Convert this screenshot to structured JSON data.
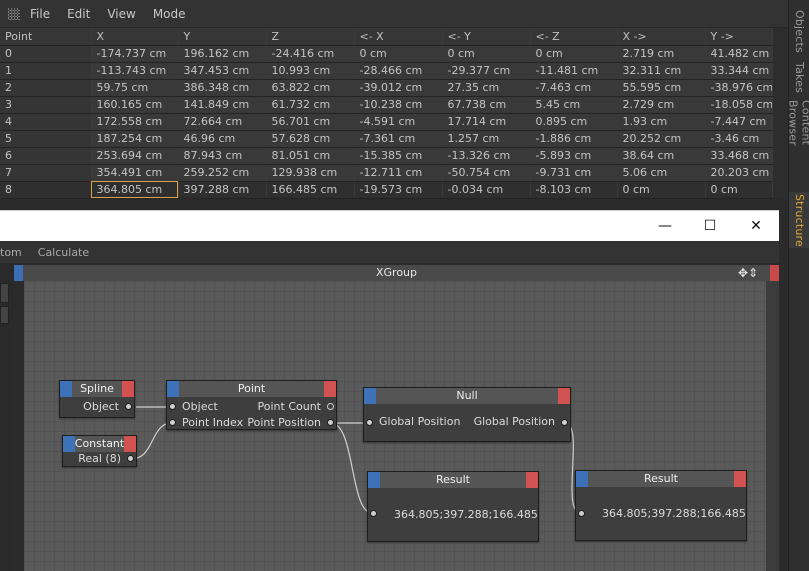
{
  "menubar": {
    "items": [
      "File",
      "Edit",
      "View",
      "Mode"
    ]
  },
  "table": {
    "columns": [
      "Point",
      "X",
      "Y",
      "Z",
      "<- X",
      "<- Y",
      "<- Z",
      "X ->",
      "Y ->"
    ],
    "rows": [
      [
        "0",
        "-174.737 cm",
        "196.162 cm",
        "-24.416 cm",
        "0 cm",
        "0 cm",
        "0 cm",
        "2.719 cm",
        "41.482 cm"
      ],
      [
        "1",
        "-113.743 cm",
        "347.453 cm",
        "10.993 cm",
        "-28.466 cm",
        "-29.377 cm",
        "-11.481 cm",
        "32.311 cm",
        "33.344 cm"
      ],
      [
        "2",
        "59.75 cm",
        "386.348 cm",
        "63.822 cm",
        "-39.012 cm",
        "27.35 cm",
        "-7.463 cm",
        "55.595 cm",
        "-38.976 cm"
      ],
      [
        "3",
        "160.165 cm",
        "141.849 cm",
        "61.732 cm",
        "-10.238 cm",
        "67.738 cm",
        "5.45 cm",
        "2.729 cm",
        "-18.058 cm"
      ],
      [
        "4",
        "172.558 cm",
        "72.664 cm",
        "56.701 cm",
        "-4.591 cm",
        "17.714 cm",
        "0.895 cm",
        "1.93 cm",
        "-7.447 cm"
      ],
      [
        "5",
        "187.254 cm",
        "46.96 cm",
        "57.628 cm",
        "-7.361 cm",
        "1.257 cm",
        "-1.886 cm",
        "20.252 cm",
        "-3.46 cm"
      ],
      [
        "6",
        "253.694 cm",
        "87.943 cm",
        "81.051 cm",
        "-15.385 cm",
        "-13.326 cm",
        "-5.893 cm",
        "38.64 cm",
        "33.468 cm"
      ],
      [
        "7",
        "354.491 cm",
        "259.252 cm",
        "129.938 cm",
        "-12.711 cm",
        "-50.754 cm",
        "-9.731 cm",
        "5.06 cm",
        "20.203 cm"
      ],
      [
        "8",
        "364.805 cm",
        "397.288 cm",
        "166.485 cm",
        "-19.573 cm",
        "-0.034 cm",
        "-8.103 cm",
        "0 cm",
        "0 cm"
      ]
    ],
    "selected_row": 8
  },
  "side_tabs": [
    "Objects",
    "Takes",
    "Content Browser",
    "Structure"
  ],
  "active_side_tab": "Structure",
  "window_controls": {
    "minimize": "—",
    "maximize": "☐",
    "close": "✕"
  },
  "xpresso": {
    "menu": [
      "tom",
      "Calculate"
    ],
    "group_title": "XGroup",
    "header_icons": "✥⇕",
    "nodes": {
      "spline": {
        "title": "Spline",
        "out_port": "Object"
      },
      "constant": {
        "title": "Constant",
        "out_port": "Real (8)"
      },
      "point": {
        "title": "Point",
        "in_ports": [
          "Object",
          "Point Index"
        ],
        "out_ports": [
          "Point Count",
          "Point Position"
        ]
      },
      "null": {
        "title": "Null",
        "in_port": "Global Position",
        "out_port": "Global Position"
      },
      "result1": {
        "title": "Result",
        "value": "364.805;397.288;166.485"
      },
      "result2": {
        "title": "Result",
        "value": "364.805;397.288;166.485"
      }
    }
  },
  "colors": {
    "input_pin": "#3d72b8",
    "output_pin": "#d25252",
    "active_tab": "#e0a93a",
    "active_cell_outline": "#d8a24c"
  }
}
